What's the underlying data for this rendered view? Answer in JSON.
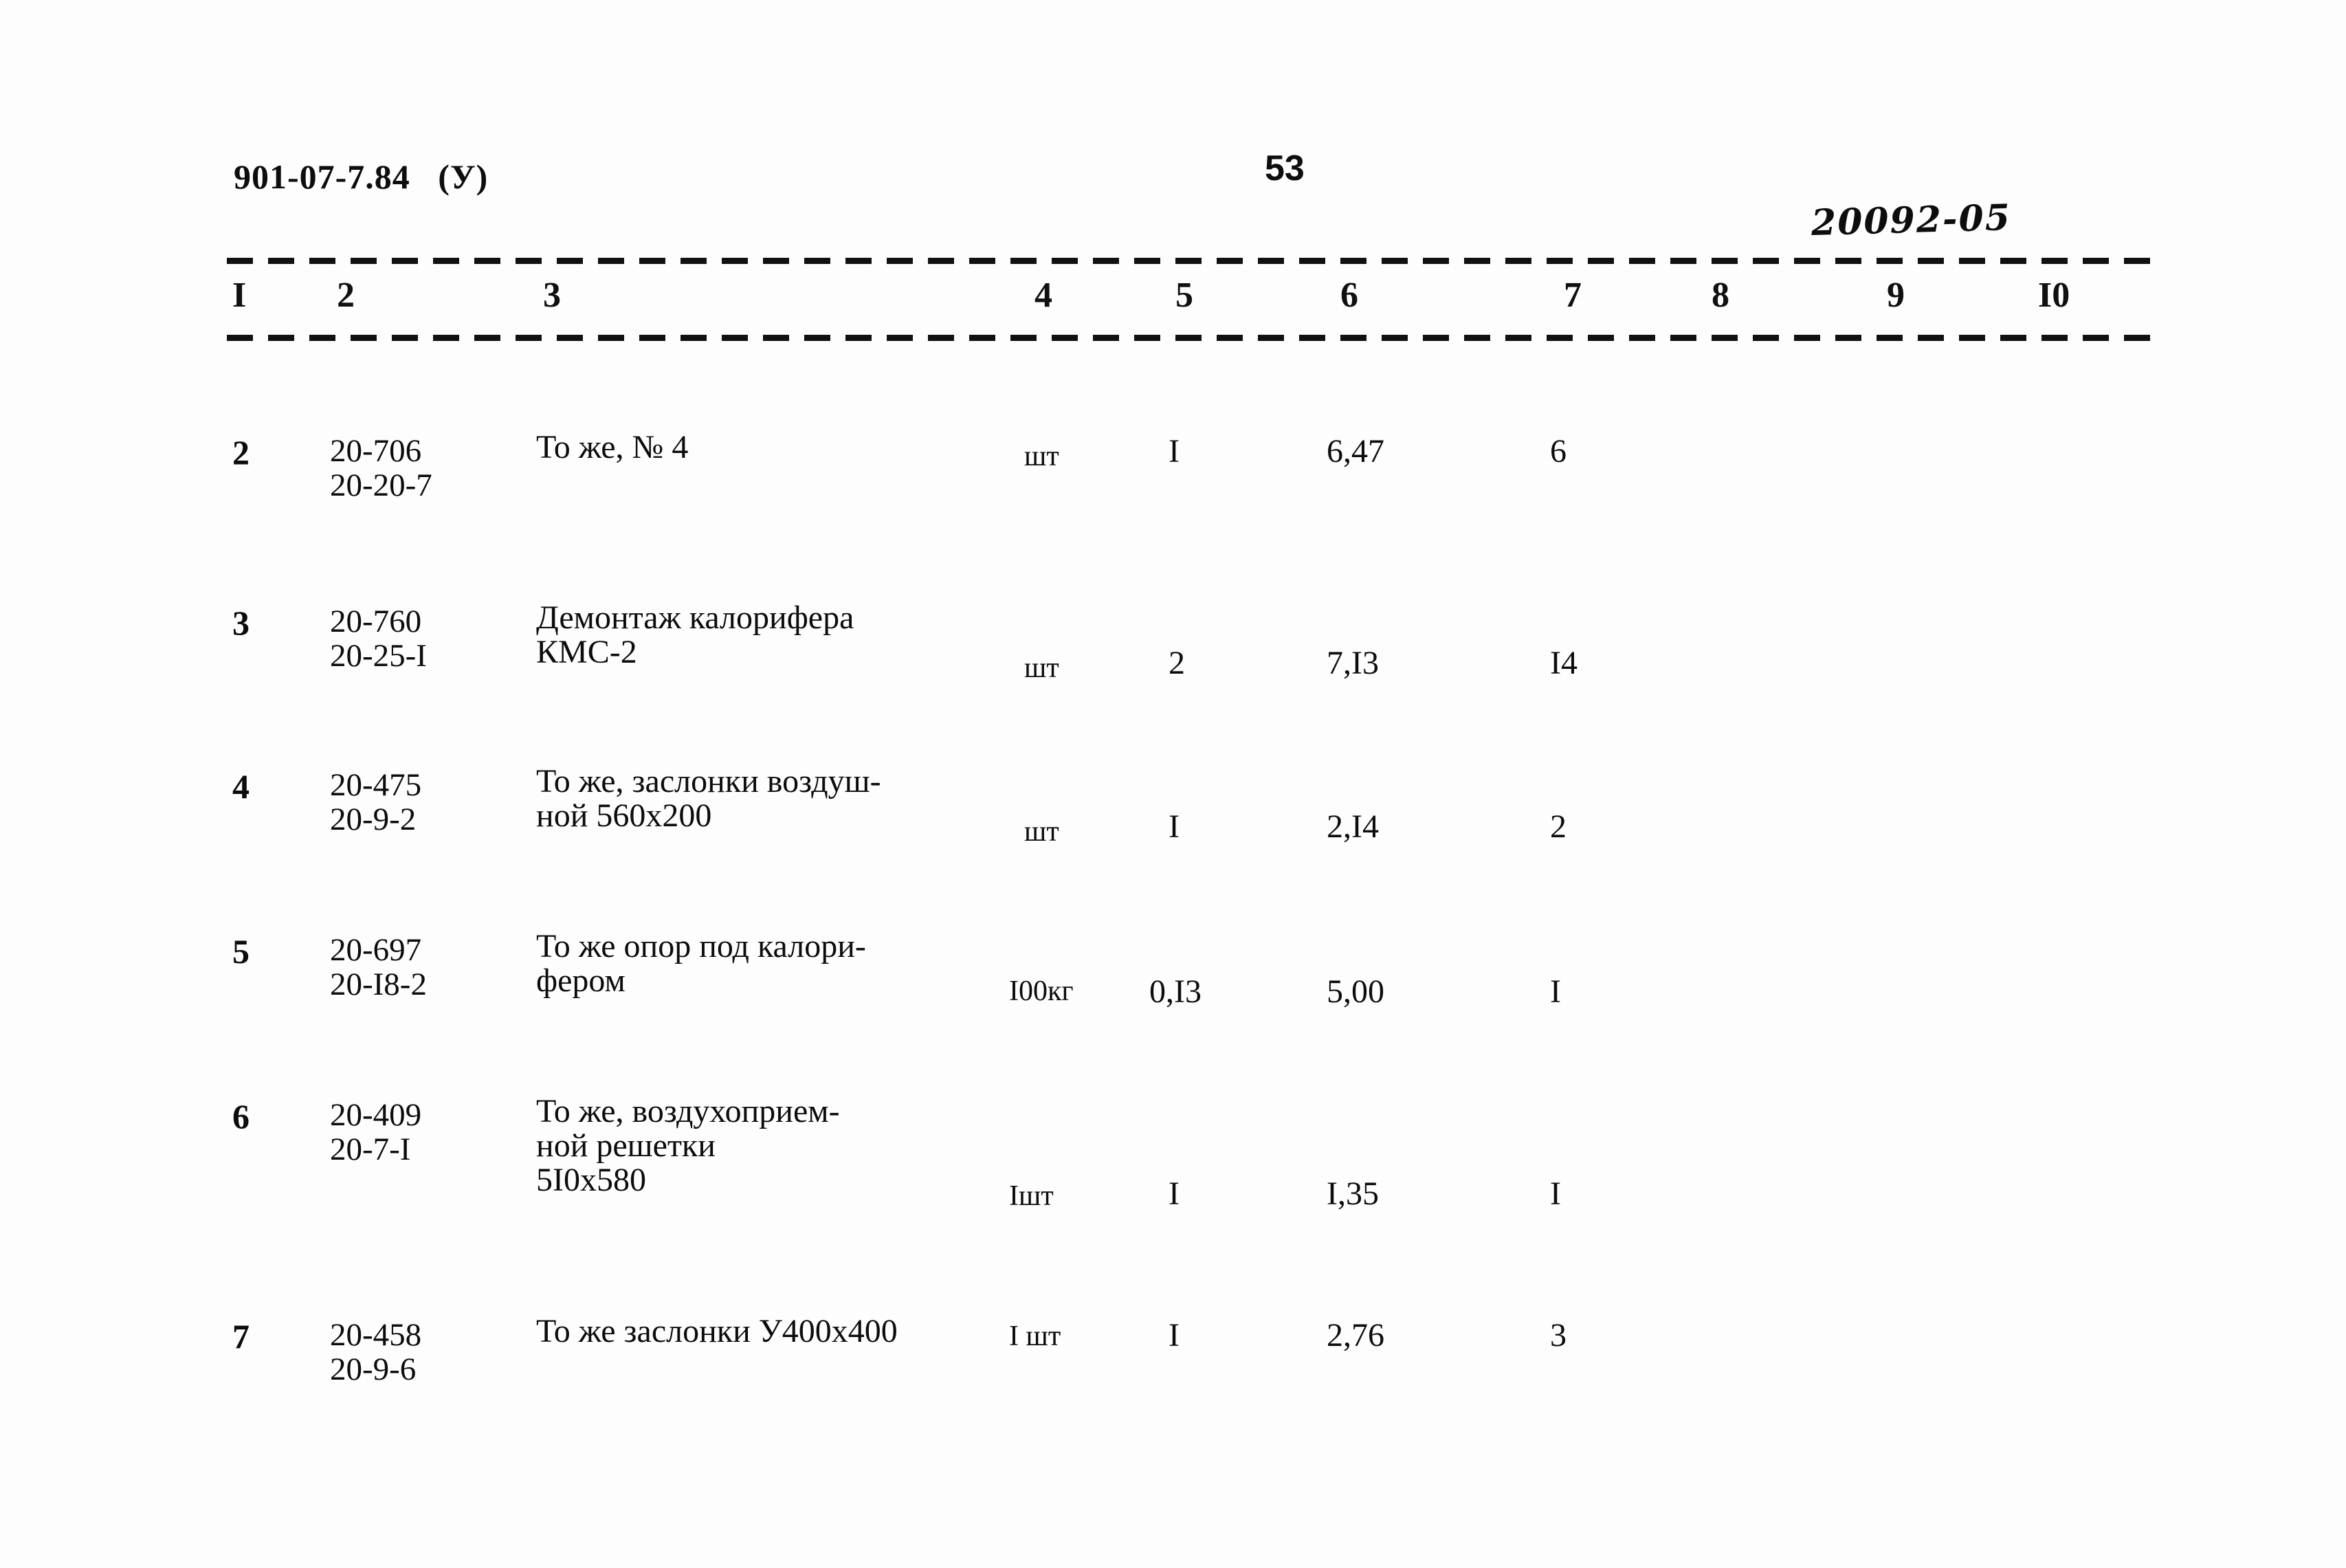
{
  "header": {
    "doc_code": "901-07-7.84   (У)",
    "page_number": "53",
    "handwritten_note": "20092-05"
  },
  "table": {
    "column_headers": [
      "I",
      "2",
      "3",
      "4",
      "5",
      "6",
      "7",
      "8",
      "9",
      "I0"
    ],
    "rows": [
      {
        "no": "2",
        "code_line1": "20-706",
        "code_line2": "20-20-7",
        "description_line1": "То же, № 4",
        "description_line2": "",
        "description_line3": "",
        "unit": "шт",
        "qty": "I",
        "norm": "6,47",
        "total": "6"
      },
      {
        "no": "3",
        "code_line1": "20-760",
        "code_line2": "20-25-I",
        "description_line1": "Демонтаж калорифера",
        "description_line2": "КМС-2",
        "description_line3": "",
        "unit": "шт",
        "qty": "2",
        "norm": "7,I3",
        "total": "I4"
      },
      {
        "no": "4",
        "code_line1": "20-475",
        "code_line2": "20-9-2",
        "description_line1": "То же, заслонки воздуш-",
        "description_line2": "ной 560х200",
        "description_line3": "",
        "unit": "шт",
        "qty": "I",
        "norm": "2,I4",
        "total": "2"
      },
      {
        "no": "5",
        "code_line1": "20-697",
        "code_line2": "20-I8-2",
        "description_line1": "То же опор под калори-",
        "description_line2": "фером",
        "description_line3": "",
        "unit": "I00кг",
        "qty": "0,I3",
        "norm": "5,00",
        "total": "I"
      },
      {
        "no": "6",
        "code_line1": "20-409",
        "code_line2": "20-7-I",
        "description_line1": "То же, воздухоприем-",
        "description_line2": "ной решетки",
        "description_line3": "5I0х580",
        "unit": "Iшт",
        "qty": "I",
        "norm": "I,35",
        "total": "I"
      },
      {
        "no": "7",
        "code_line1": "20-458",
        "code_line2": "20-9-6",
        "description_line1": "То же заслонки У400х400",
        "description_line2": "",
        "description_line3": "",
        "unit": "I шт",
        "qty": "I",
        "norm": "2,76",
        "total": "3"
      }
    ]
  }
}
